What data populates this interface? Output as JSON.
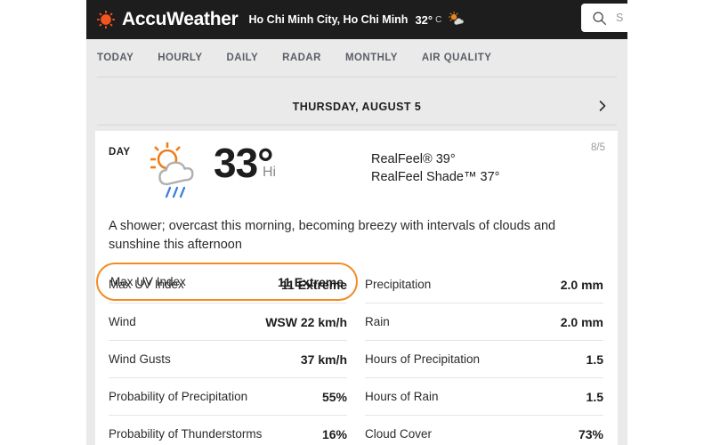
{
  "header": {
    "brand": "AccuWeather",
    "logo_icon": "sun-logo-icon",
    "location": "Ho Chi Minh City, Ho Chi Minh",
    "current_temp": "32°",
    "unit": "C",
    "condition_icon": "sun-behind-cloud-icon",
    "search": {
      "icon": "search-icon",
      "text": "S",
      "placeholder": "Search"
    },
    "background_color": "#1d1d1d"
  },
  "nav": {
    "items": [
      {
        "label": "TODAY"
      },
      {
        "label": "HOURLY"
      },
      {
        "label": "DAILY"
      },
      {
        "label": "RADAR"
      },
      {
        "label": "MONTHLY"
      },
      {
        "label": "AIR QUALITY"
      }
    ]
  },
  "date_strip": {
    "label": "THURSDAY, AUGUST 5",
    "next_icon": "chevron-right-icon"
  },
  "forecast": {
    "period_label": "DAY",
    "weather_icon": "sun-behind-rain-cloud-icon",
    "temperature": "33°",
    "temp_qualifier": "Hi",
    "realfeel": "RealFeel® 39°",
    "realfeel_shade": "RealFeel Shade™ 37°",
    "mini_date": "8/5",
    "description": "A shower; overcast this morning, becoming breezy with intervals of clouds and sunshine this afternoon"
  },
  "highlight": {
    "label": "Max UV Index",
    "value": "11 Extreme",
    "border_color": "#f28b25"
  },
  "details": {
    "left": [
      {
        "label": "Wind",
        "value": "WSW 22 km/h"
      },
      {
        "label": "Wind Gusts",
        "value": "37 km/h"
      },
      {
        "label": "Probability of Precipitation",
        "value": "55%"
      },
      {
        "label": "Probability of Thunderstorms",
        "value": "16%"
      }
    ],
    "right": [
      {
        "label": "Precipitation",
        "value": "2.0 mm"
      },
      {
        "label": "Rain",
        "value": "2.0 mm"
      },
      {
        "label": "Hours of Precipitation",
        "value": "1.5"
      },
      {
        "label": "Hours of Rain",
        "value": "1.5"
      },
      {
        "label": "Cloud Cover",
        "value": "73%"
      }
    ]
  },
  "colors": {
    "brand_orange": "#f07d1a",
    "page_background": "#eaeaea",
    "card_background": "#ffffff"
  }
}
